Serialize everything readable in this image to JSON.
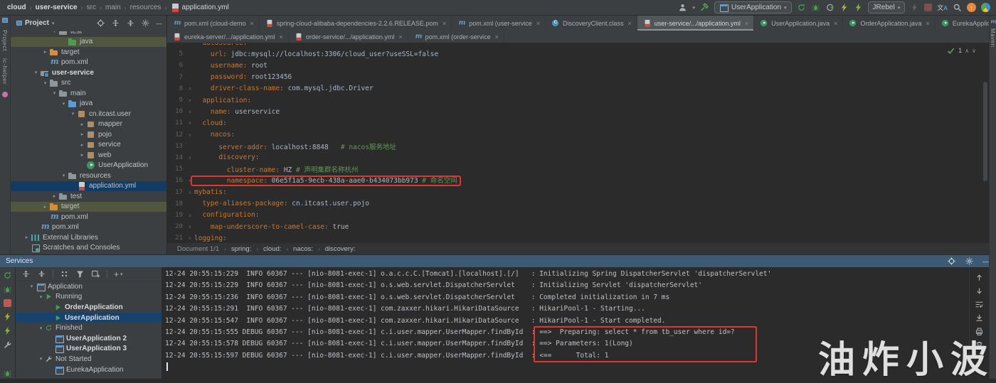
{
  "titlebar": {
    "breadcrumb": [
      {
        "label": "cloud",
        "style": "bold"
      },
      {
        "label": "user-service",
        "style": "bold"
      },
      {
        "label": "src",
        "style": "dim"
      },
      {
        "label": "main",
        "style": "dim"
      },
      {
        "label": "resources",
        "style": "dim"
      },
      {
        "label": "application.yml",
        "style": "file"
      }
    ],
    "run_config_label": "UserApplication",
    "jrebel_label": "JRebel"
  },
  "left_strip": {
    "top_label": "Project",
    "bottom_label": "ic-helper"
  },
  "right_strip": {
    "label": "Maven"
  },
  "project": {
    "header_title": "Project",
    "tree": [
      {
        "label": "test",
        "level": 4,
        "icon": "folder fc-gray",
        "chevron": "down"
      },
      {
        "label": "java",
        "level": 5,
        "icon": "folder fc-green",
        "row": "olive"
      },
      {
        "label": "target",
        "level": 3,
        "icon": "folder fc-orange",
        "chevron": "right"
      },
      {
        "label": "pom.xml",
        "level": 3,
        "icon": "maven"
      },
      {
        "label": "user-service",
        "level": 2,
        "icon": "module",
        "chevron": "down",
        "bold": true
      },
      {
        "label": "src",
        "level": 3,
        "icon": "folder fc-gray",
        "chevron": "down"
      },
      {
        "label": "main",
        "level": 4,
        "icon": "folder fc-gray",
        "chevron": "down"
      },
      {
        "label": "java",
        "level": 5,
        "icon": "folder fc-blue",
        "chevron": "down"
      },
      {
        "label": "cn.itcast.user",
        "level": 6,
        "icon": "package",
        "chevron": "down"
      },
      {
        "label": "mapper",
        "level": 7,
        "icon": "package",
        "chevron": "right"
      },
      {
        "label": "pojo",
        "level": 7,
        "icon": "package",
        "chevron": "right"
      },
      {
        "label": "service",
        "level": 7,
        "icon": "package",
        "chevron": "right"
      },
      {
        "label": "web",
        "level": 7,
        "icon": "package",
        "chevron": "right"
      },
      {
        "label": "UserApplication",
        "level": 7,
        "icon": "class-run"
      },
      {
        "label": "resources",
        "level": 5,
        "icon": "folder fc-gray",
        "chevron": "down"
      },
      {
        "label": "application.yml",
        "level": 6,
        "icon": "yml",
        "row": "selected"
      },
      {
        "label": "test",
        "level": 4,
        "icon": "folder fc-gray",
        "chevron": "right"
      },
      {
        "label": "target",
        "level": 3,
        "icon": "folder fc-orange",
        "chevron": "right",
        "row": "olive"
      },
      {
        "label": "pom.xml",
        "level": 3,
        "icon": "maven"
      },
      {
        "label": "pom.xml",
        "level": 2,
        "icon": "maven"
      },
      {
        "label": "External Libraries",
        "level": 1,
        "icon": "lib",
        "chevron": "right"
      },
      {
        "label": "Scratches and Consoles",
        "level": 1,
        "icon": "scratch"
      }
    ]
  },
  "tabs": {
    "row1": [
      {
        "icon": "maven",
        "label": "pom.xml (cloud-demo"
      },
      {
        "icon": "yml",
        "label": "spring-cloud-alibaba-dependencies-2.2.6.RELEASE.pom"
      },
      {
        "icon": "maven",
        "label": "pom.xml (user-service"
      },
      {
        "icon": "class-blue",
        "label": "DiscoveryClient.class"
      },
      {
        "icon": "yml",
        "label": "user-service/.../application.yml",
        "active": true
      },
      {
        "icon": "class-run",
        "label": "UserApplication.java"
      },
      {
        "icon": "class-run",
        "label": "OrderApplication.java"
      },
      {
        "icon": "class-run",
        "label": "EurekaApplication.java"
      }
    ],
    "row2": [
      {
        "icon": "yml",
        "label": "eureka-server/.../application.yml"
      },
      {
        "icon": "yml",
        "label": "order-service/.../application.yml"
      },
      {
        "icon": "maven",
        "label": "pom.xml (order-service"
      }
    ]
  },
  "editor": {
    "inspection_count": "1",
    "lines": [
      {
        "num": "4",
        "key": "  datasource:",
        "value": "",
        "comment": "",
        "fold": ""
      },
      {
        "num": "5",
        "key": "    url:",
        "value": " jdbc:mysql://localhost:3306/cloud_user?useSSL=false",
        "comment": "",
        "fold": ""
      },
      {
        "num": "6",
        "key": "    username:",
        "value": " root",
        "comment": "",
        "fold": ""
      },
      {
        "num": "7",
        "key": "    password:",
        "value": " root123456",
        "comment": "",
        "fold": ""
      },
      {
        "num": "8",
        "key": "    driver-class-name:",
        "value": " com.mysql.jdbc.Driver",
        "comment": "",
        "fold": "up"
      },
      {
        "num": "9",
        "key": "  application:",
        "value": "",
        "comment": "",
        "fold": "down"
      },
      {
        "num": "10",
        "key": "    name:",
        "value": " userservice",
        "comment": "",
        "fold": "up"
      },
      {
        "num": "11",
        "key": "  cloud:",
        "value": "",
        "comment": "",
        "fold": "down"
      },
      {
        "num": "12",
        "key": "    nacos:",
        "value": "",
        "comment": "",
        "fold": "down"
      },
      {
        "num": "13",
        "key": "      server-addr:",
        "value": " localhost:8848",
        "comment": "   # nacos服务地址",
        "fold": ""
      },
      {
        "num": "14",
        "key": "      discovery:",
        "value": "",
        "comment": "",
        "fold": "down"
      },
      {
        "num": "15",
        "key": "        cluster-name:",
        "value": " HZ",
        "comment": " # 声明集群名称杭州",
        "fold": ""
      },
      {
        "num": "16",
        "key": "        namespace:",
        "value": " 06e5f1a5-9ecb-438a-aae0-b434073bb973",
        "comment": " # 命名空间",
        "fold": "up",
        "boxed": true
      },
      {
        "num": "17",
        "key": "mybatis:",
        "value": "",
        "comment": "",
        "fold": "down"
      },
      {
        "num": "18",
        "key": "  type-aliases-package:",
        "value": " cn.itcast.user.pojo",
        "comment": "",
        "fold": ""
      },
      {
        "num": "19",
        "key": "  configuration:",
        "value": "",
        "comment": "",
        "fold": "down"
      },
      {
        "num": "20",
        "key": "    map-underscore-to-camel-case:",
        "value": " true",
        "comment": "",
        "fold": "up"
      },
      {
        "num": "21",
        "key": "logging:",
        "value": "",
        "comment": "",
        "fold": "down"
      }
    ],
    "breadcrumb": [
      "Document 1/1",
      "spring:",
      "cloud:",
      "nacos:",
      "discovery:"
    ]
  },
  "services": {
    "title": "Services",
    "tree": [
      {
        "label": "Application",
        "level": 1,
        "icon": "app",
        "chevron": "down"
      },
      {
        "label": "Running",
        "level": 2,
        "icon": "play",
        "chevron": "down"
      },
      {
        "label": "OrderApplication",
        "level": 3,
        "icon": "play",
        "bold": true
      },
      {
        "label": "UserApplication",
        "level": 3,
        "icon": "play",
        "bold": true,
        "row": "selected"
      },
      {
        "label": "Finished",
        "level": 2,
        "icon": "rerun",
        "chevron": "down"
      },
      {
        "label": "UserApplication 2",
        "level": 3,
        "icon": "app",
        "bold": true
      },
      {
        "label": "UserApplication 3",
        "level": 3,
        "icon": "app",
        "bold": true
      },
      {
        "label": "Not Started",
        "level": 2,
        "icon": "wrench",
        "chevron": "down"
      },
      {
        "label": "EurekaApplication",
        "level": 3,
        "icon": "app"
      }
    ],
    "console_lines": [
      {
        "time": "12-24 20:55:15:229",
        "level": "INFO",
        "pid": "60367",
        "thread": "[nio-8081-exec-1]",
        "logger": "o.a.c.c.C.[Tomcat].[localhost].[/]",
        "msg": ": Initializing Spring DispatcherServlet 'dispatcherServlet'"
      },
      {
        "time": "12-24 20:55:15:229",
        "level": "INFO",
        "pid": "60367",
        "thread": "[nio-8081-exec-1]",
        "logger": "o.s.web.servlet.DispatcherServlet",
        "msg": ": Initializing Servlet 'dispatcherServlet'"
      },
      {
        "time": "12-24 20:55:15:236",
        "level": "INFO",
        "pid": "60367",
        "thread": "[nio-8081-exec-1]",
        "logger": "o.s.web.servlet.DispatcherServlet",
        "msg": ": Completed initialization in 7 ms"
      },
      {
        "time": "12-24 20:55:15:291",
        "level": "INFO",
        "pid": "60367",
        "thread": "[nio-8081-exec-1]",
        "logger": "com.zaxxer.hikari.HikariDataSource",
        "msg": ": HikariPool-1 - Starting..."
      },
      {
        "time": "12-24 20:55:15:547",
        "level": "INFO",
        "pid": "60367",
        "thread": "[nio-8081-exec-1]",
        "logger": "com.zaxxer.hikari.HikariDataSource",
        "msg": ": HikariPool-1 - Start completed."
      },
      {
        "time": "12-24 20:55:15:555",
        "level": "DEBUG",
        "pid": "60367",
        "thread": "[nio-8081-exec-1]",
        "logger": "c.i.user.mapper.UserMapper.findById",
        "msg": ": ==>  Preparing: select * from tb_user where id=?"
      },
      {
        "time": "12-24 20:55:15:578",
        "level": "DEBUG",
        "pid": "60367",
        "thread": "[nio-8081-exec-1]",
        "logger": "c.i.user.mapper.UserMapper.findById",
        "msg": ": ==> Parameters: 1(Long)"
      },
      {
        "time": "12-24 20:55:15:597",
        "level": "DEBUG",
        "pid": "60367",
        "thread": "[nio-8081-exec-1]",
        "logger": "c.i.user.mapper.UserMapper.findById",
        "msg": ": <==      Total: 1"
      }
    ]
  },
  "watermark": "油炸小波"
}
